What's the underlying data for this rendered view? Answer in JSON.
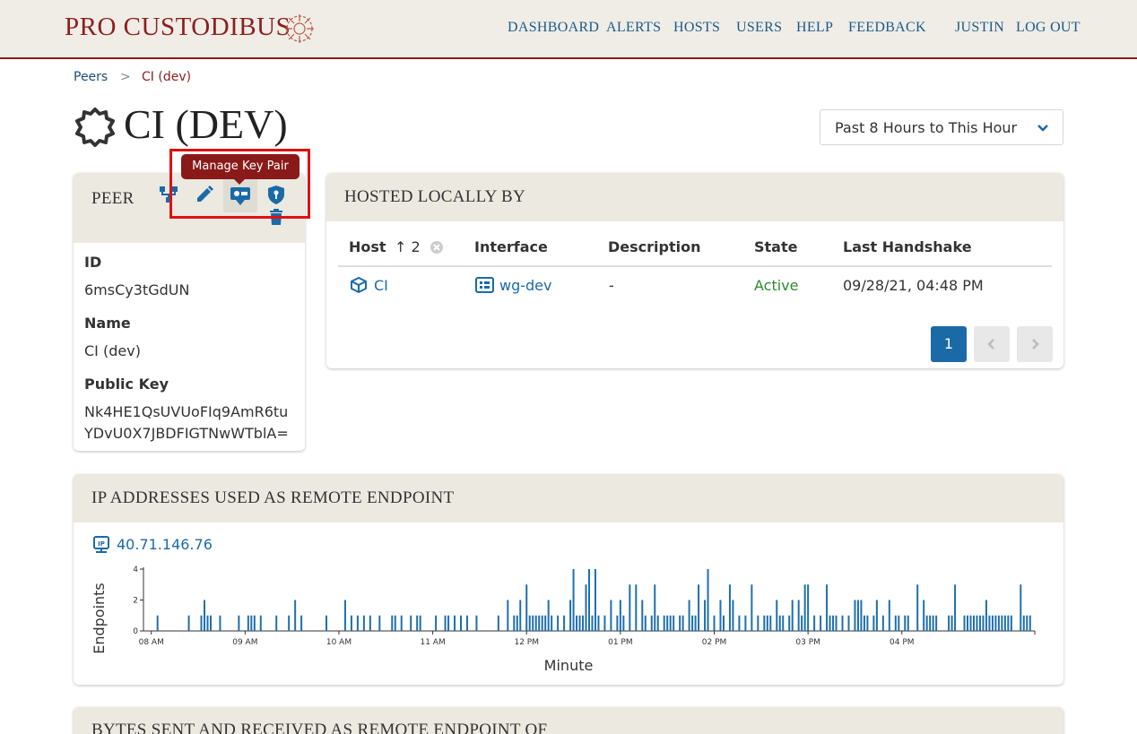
{
  "brand": {
    "name": "PRO CUSTODIBUS"
  },
  "nav": [
    "DASHBOARD",
    "ALERTS",
    "HOSTS",
    "USERS",
    "HELP",
    "FEEDBACK",
    "JUSTIN",
    "LOG OUT"
  ],
  "breadcrumb": {
    "parent": "Peers",
    "separator": ">",
    "current": "CI (dev)"
  },
  "page_title": "CI (DEV)",
  "time_range": {
    "selected": "Past 8 Hours to This Hour"
  },
  "peer": {
    "heading": "PEER",
    "tooltip": "Manage Key Pair",
    "fields": [
      {
        "label": "ID",
        "value": "6msCy3tGdUN"
      },
      {
        "label": "Name",
        "value": "CI (dev)"
      },
      {
        "label": "Public Key",
        "value_lines": [
          "Nk4HE1QsUVUoFIq9AmR6tu",
          "YDvU0X7JBDFIGTNwWTblA="
        ]
      }
    ]
  },
  "hosted": {
    "heading": "HOSTED LOCALLY BY",
    "columns": [
      "Host",
      "Interface",
      "Description",
      "State",
      "Last Handshake"
    ],
    "sort_indicator": "↑ 2",
    "rows": [
      {
        "host": "CI",
        "interface": "wg-dev",
        "description": "-",
        "state": "Active",
        "last_handshake": "09/28/21, 04:48 PM"
      }
    ],
    "pagination": {
      "current": "1"
    }
  },
  "ip_section": {
    "heading": "IP ADDRESSES USED AS REMOTE ENDPOINT",
    "address": "40.71.146.76"
  },
  "bytes_section": {
    "heading": "BYTES SENT AND RECEIVED AS REMOTE ENDPOINT OF"
  },
  "colors": {
    "brand": "#8b1f1f",
    "link": "#1a6aa8",
    "bar": "#1f6fad",
    "active": "#2e8b2e"
  },
  "chart_data": {
    "type": "bar",
    "xlabel": "Minute",
    "ylabel": "Endpoints",
    "ylim": [
      0,
      4
    ],
    "yticks": [
      0,
      2,
      4
    ],
    "x_ticks": [
      "08 AM",
      "09 AM",
      "10 AM",
      "11 AM",
      "12 PM",
      "01 PM",
      "02 PM",
      "03 PM",
      "04 PM"
    ],
    "x_range_minutes": [
      0,
      540
    ],
    "points": [
      [
        4,
        1
      ],
      [
        24,
        1
      ],
      [
        32,
        1
      ],
      [
        34,
        2
      ],
      [
        36,
        1
      ],
      [
        38,
        1
      ],
      [
        44,
        1
      ],
      [
        56,
        1
      ],
      [
        62,
        1
      ],
      [
        64,
        1
      ],
      [
        66,
        1
      ],
      [
        70,
        1
      ],
      [
        80,
        1
      ],
      [
        88,
        1
      ],
      [
        92,
        2
      ],
      [
        96,
        1
      ],
      [
        112,
        1
      ],
      [
        124,
        2
      ],
      [
        128,
        1
      ],
      [
        132,
        1
      ],
      [
        136,
        1
      ],
      [
        140,
        1
      ],
      [
        146,
        1
      ],
      [
        154,
        1
      ],
      [
        156,
        1
      ],
      [
        160,
        1
      ],
      [
        166,
        1
      ],
      [
        170,
        1
      ],
      [
        172,
        1
      ],
      [
        182,
        1
      ],
      [
        188,
        1
      ],
      [
        190,
        1
      ],
      [
        194,
        1
      ],
      [
        198,
        1
      ],
      [
        202,
        1
      ],
      [
        208,
        1
      ],
      [
        222,
        1
      ],
      [
        228,
        2
      ],
      [
        232,
        1
      ],
      [
        234,
        1
      ],
      [
        236,
        2
      ],
      [
        240,
        3
      ],
      [
        242,
        1
      ],
      [
        244,
        1
      ],
      [
        246,
        1
      ],
      [
        248,
        1
      ],
      [
        250,
        1
      ],
      [
        252,
        1
      ],
      [
        254,
        2
      ],
      [
        256,
        1
      ],
      [
        260,
        1
      ],
      [
        264,
        1
      ],
      [
        268,
        2
      ],
      [
        270,
        4
      ],
      [
        272,
        1
      ],
      [
        274,
        1
      ],
      [
        276,
        1
      ],
      [
        278,
        3
      ],
      [
        280,
        4
      ],
      [
        282,
        1
      ],
      [
        284,
        4
      ],
      [
        286,
        1
      ],
      [
        290,
        1
      ],
      [
        294,
        2
      ],
      [
        298,
        1
      ],
      [
        300,
        2
      ],
      [
        302,
        1
      ],
      [
        306,
        3
      ],
      [
        310,
        3
      ],
      [
        314,
        2
      ],
      [
        316,
        1
      ],
      [
        320,
        1
      ],
      [
        322,
        3
      ],
      [
        324,
        1
      ],
      [
        328,
        1
      ],
      [
        330,
        1
      ],
      [
        332,
        1
      ],
      [
        334,
        1
      ],
      [
        338,
        1
      ],
      [
        340,
        1
      ],
      [
        344,
        2
      ],
      [
        346,
        1
      ],
      [
        348,
        1
      ],
      [
        350,
        3
      ],
      [
        354,
        2
      ],
      [
        356,
        4
      ],
      [
        360,
        1
      ],
      [
        364,
        2
      ],
      [
        366,
        1
      ],
      [
        370,
        3
      ],
      [
        372,
        2
      ],
      [
        376,
        1
      ],
      [
        380,
        1
      ],
      [
        384,
        3
      ],
      [
        388,
        1
      ],
      [
        392,
        1
      ],
      [
        394,
        1
      ],
      [
        396,
        1
      ],
      [
        400,
        2
      ],
      [
        402,
        1
      ],
      [
        404,
        1
      ],
      [
        408,
        1
      ],
      [
        410,
        2
      ],
      [
        414,
        2
      ],
      [
        416,
        1
      ],
      [
        418,
        3
      ],
      [
        420,
        3
      ],
      [
        424,
        1
      ],
      [
        428,
        1
      ],
      [
        432,
        3
      ],
      [
        434,
        1
      ],
      [
        436,
        1
      ],
      [
        438,
        1
      ],
      [
        442,
        1
      ],
      [
        446,
        1
      ],
      [
        450,
        2
      ],
      [
        452,
        2
      ],
      [
        454,
        2
      ],
      [
        456,
        1
      ],
      [
        458,
        1
      ],
      [
        462,
        1
      ],
      [
        464,
        2
      ],
      [
        468,
        1
      ],
      [
        472,
        2
      ],
      [
        476,
        1
      ],
      [
        478,
        1
      ],
      [
        482,
        1
      ],
      [
        484,
        1
      ],
      [
        490,
        3
      ],
      [
        494,
        2
      ],
      [
        496,
        1
      ],
      [
        498,
        1
      ],
      [
        500,
        1
      ],
      [
        502,
        1
      ],
      [
        510,
        1
      ],
      [
        512,
        1
      ],
      [
        514,
        3
      ],
      [
        520,
        1
      ],
      [
        522,
        1
      ],
      [
        524,
        1
      ],
      [
        526,
        1
      ],
      [
        528,
        1
      ],
      [
        530,
        1
      ],
      [
        532,
        1
      ],
      [
        534,
        2
      ],
      [
        536,
        1
      ],
      [
        538,
        1
      ],
      [
        540,
        1
      ],
      [
        542,
        1
      ],
      [
        544,
        1
      ],
      [
        546,
        1
      ],
      [
        548,
        1
      ],
      [
        550,
        1
      ],
      [
        556,
        3
      ],
      [
        558,
        1
      ],
      [
        560,
        1
      ],
      [
        562,
        1
      ]
    ]
  }
}
